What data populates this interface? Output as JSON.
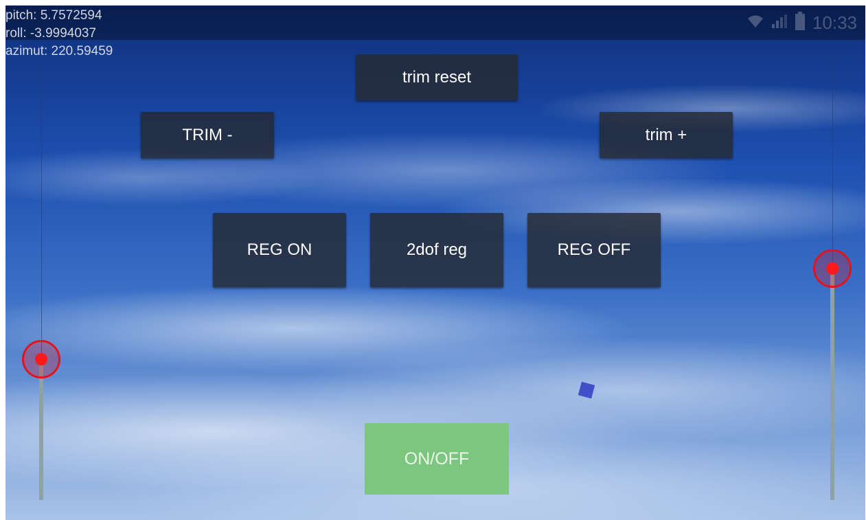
{
  "status_bar": {
    "time": "10:33",
    "icons": [
      "wifi-icon",
      "signal-icon",
      "battery-icon"
    ]
  },
  "telemetry": {
    "pitch": "pitch: 5.7572594",
    "roll": "roll: -3.9994037",
    "azimut": "azimut: 220.59459"
  },
  "buttons": {
    "trim_reset": "trim reset",
    "trim_minus": "TRIM -",
    "trim_plus": "trim +",
    "reg_on": "REG ON",
    "reg_2dof": "2dof reg",
    "reg_off": "REG OFF",
    "on_off": "ON/OFF"
  },
  "sliders": {
    "left_level": 0.3,
    "right_level": 0.5
  },
  "colors": {
    "button_bg": "#262a32",
    "on_off_bg": "#7cc67f",
    "thumb": "#e3141b",
    "track": "#8ea2a6",
    "indicator": "#4050c8"
  }
}
